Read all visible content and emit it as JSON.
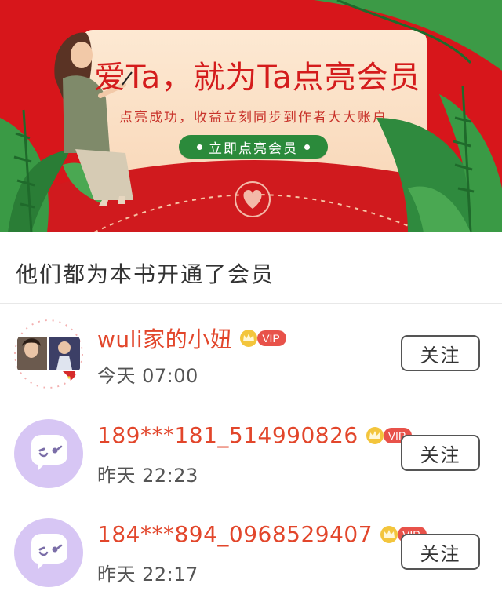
{
  "banner": {
    "title": "爱Ta，就为Ta点亮会员",
    "subtitle": "点亮成功，收益立刻同步到作者大大账户",
    "cta_label": "立即点亮会员"
  },
  "section_title": "他们都为本书开通了会员",
  "vip_label": "VIP",
  "follow_label": "关注",
  "members": [
    {
      "name": "wuli家的小妞",
      "time": "今天 07:00",
      "avatar": "photo-avatar"
    },
    {
      "name": "189***181_514990826",
      "time": "昨天 22:23",
      "avatar": "default-chat-avatar"
    },
    {
      "name": "184***894_0968529407",
      "time": "昨天 22:17",
      "avatar": "default-chat-avatar"
    }
  ],
  "colors": {
    "banner_red": "#d7161b",
    "card_cream": "#fbe3c9",
    "accent_green": "#2b8a3b",
    "name_red": "#e2462b",
    "vip_red": "#e8524a",
    "avatar_purple": "#d7c6f4"
  }
}
